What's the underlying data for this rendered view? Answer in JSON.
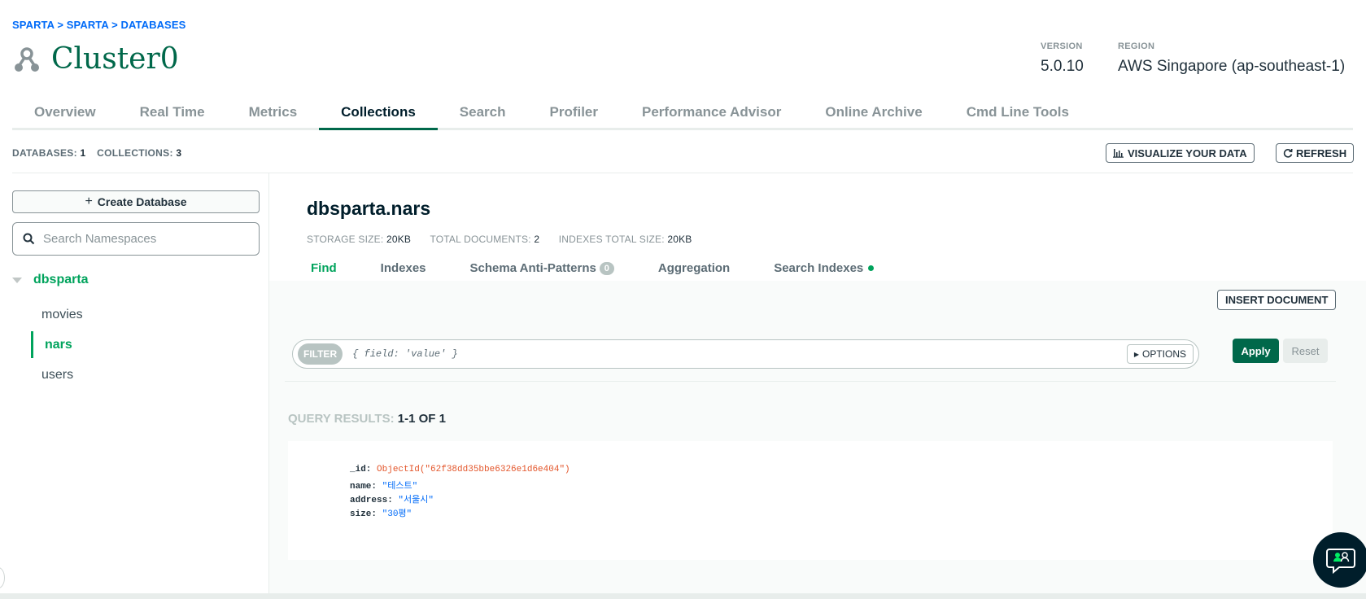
{
  "breadcrumb": "SPARTA > SPARTA > DATABASES",
  "cluster": {
    "name": "Cluster0",
    "icon": "cluster-icon"
  },
  "meta": {
    "version_label": "VERSION",
    "version_value": "5.0.10",
    "region_label": "REGION",
    "region_value": "AWS Singapore (ap-southeast-1)"
  },
  "main_tabs": [
    "Overview",
    "Real Time",
    "Metrics",
    "Collections",
    "Search",
    "Profiler",
    "Performance Advisor",
    "Online Archive",
    "Cmd Line Tools"
  ],
  "main_tab_active": "Collections",
  "stats": {
    "databases_label": "DATABASES:",
    "databases_value": "1",
    "collections_label": "COLLECTIONS:",
    "collections_value": "3"
  },
  "header_buttons": {
    "visualize": "VISUALIZE YOUR DATA",
    "refresh": "REFRESH"
  },
  "sidebar": {
    "create_db_label": "Create Database",
    "search_placeholder": "Search Namespaces",
    "database": "dbsparta",
    "collections": [
      "movies",
      "nars",
      "users"
    ],
    "active_collection": "nars"
  },
  "namespace": {
    "title": "dbsparta.nars",
    "storage_label": "STORAGE SIZE:",
    "storage_value": "20KB",
    "docs_label": "TOTAL DOCUMENTS:",
    "docs_value": "2",
    "indexes_label": "INDEXES TOTAL SIZE:",
    "indexes_value": "20KB"
  },
  "sub_tabs": {
    "find": "Find",
    "indexes": "Indexes",
    "schema": "Schema Anti-Patterns",
    "schema_badge": "0",
    "aggregation": "Aggregation",
    "search_indexes": "Search Indexes"
  },
  "find": {
    "insert_label": "INSERT DOCUMENT",
    "filter_label": "FILTER",
    "filter_placeholder": "{ field: 'value' }",
    "options_label": "OPTIONS",
    "apply_label": "Apply",
    "reset_label": "Reset",
    "results_label": "QUERY RESULTS:",
    "results_count": "1-1 OF 1"
  },
  "document": {
    "id_key": "_id:",
    "id_value": "ObjectId(\"62f38dd35bbe6326e1d6e404\")",
    "name_key": "name:",
    "name_value": "\"테스트\"",
    "address_key": "address:",
    "address_value": "\"서울시\"",
    "size_key": "size:",
    "size_value": "\"30평\""
  },
  "colors": {
    "brand_green": "#00684a",
    "accent_green": "#00a35c",
    "link_blue": "#016bf8",
    "objectid_orange": "#e3552a"
  }
}
